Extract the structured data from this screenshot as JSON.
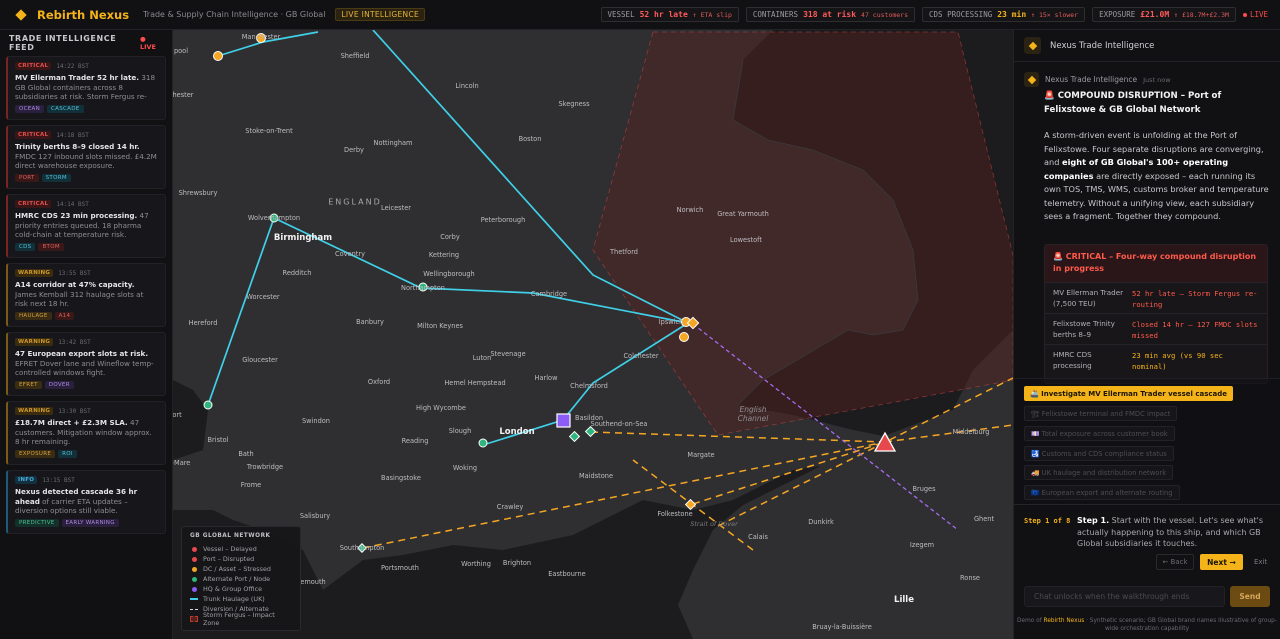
{
  "topbar": {
    "brand": "Rebirth Nexus",
    "subtitle": "Trade & Supply Chain Intelligence · GB Global",
    "mode": "LIVE INTELLIGENCE",
    "metrics": [
      {
        "label": "VESSEL",
        "value": "52 hr late",
        "delta": "↑ ETA slip"
      },
      {
        "label": "CONTAINERS",
        "value": "318 at risk",
        "delta": "47 customers"
      },
      {
        "label": "CDS PROCESSING",
        "value": "23 min",
        "delta": "↑ 15× slower"
      },
      {
        "label": "EXPOSURE",
        "value": "£21.0M",
        "delta": "↑ £18.7M+£2.3M"
      }
    ],
    "live": "LIVE"
  },
  "feed": {
    "title": "TRADE INTELLIGENCE FEED",
    "live": "● LIVE",
    "items": [
      {
        "severity": "CRITICAL",
        "time": "14:22 BST",
        "headline": "MV Ellerman Trader 52 hr late.",
        "body": " 318 GB Global containers across 8 subsidiaries at risk. Storm Fergus re-routing.",
        "tags": [
          "OCEAN",
          "CASCADE"
        ]
      },
      {
        "severity": "CRITICAL",
        "time": "14:18 BST",
        "headline": "Trinity berths 8–9 closed 14 hr.",
        "body": " FMDC 127 inbound slots missed. £4.2M direct warehouse exposure.",
        "tags": [
          "PORT",
          "STORM"
        ]
      },
      {
        "severity": "CRITICAL",
        "time": "14:14 BST",
        "headline": "HMRC CDS 23 min processing.",
        "body": " 47 priority entries queued. 18 pharma cold-chain at temperature risk.",
        "tags": [
          "CDS",
          "BTOM"
        ]
      },
      {
        "severity": "WARNING",
        "time": "13:55 BST",
        "headline": "A14 corridor at 47% capacity.",
        "body": " James Kemball 312 haulage slots at risk next 18 hr.",
        "tags": [
          "HAULAGE",
          "A14"
        ]
      },
      {
        "severity": "WARNING",
        "time": "13:42 BST",
        "headline": "47 European export slots at risk.",
        "body": " EFRET Dover lane and Wineflow temp-controlled windows fight.",
        "tags": [
          "EFRET",
          "DOVER"
        ]
      },
      {
        "severity": "WARNING",
        "time": "13:30 BST",
        "headline": "£18.7M direct + £2.3M SLA.",
        "body": " 47 customers. Mitigation window approx. 8 hr remaining.",
        "tags": [
          "EXPOSURE",
          "ROI"
        ]
      },
      {
        "severity": "INFO",
        "time": "13:15 BST",
        "headline": "Nexus detected cascade 36 hr ahead",
        "body": " of carrier ETA updates – diversion options still viable.",
        "tags": [
          "PREDICTIVE",
          "EARLY WARNING"
        ]
      }
    ]
  },
  "map": {
    "cities": [
      {
        "name": "Manchester",
        "big": false
      },
      {
        "name": "Sheffield",
        "big": false
      },
      {
        "name": "pool",
        "big": false
      },
      {
        "name": "Lincoln",
        "big": false
      },
      {
        "name": "Skegness",
        "big": false
      },
      {
        "name": "hester",
        "big": false
      },
      {
        "name": "Stoke-on-Trent",
        "big": false
      },
      {
        "name": "Nottingham",
        "big": false
      },
      {
        "name": "Boston",
        "big": false
      },
      {
        "name": "Derby",
        "big": false
      },
      {
        "name": "Shrewsbury",
        "big": false
      },
      {
        "name": "ENGLAND",
        "big": false
      },
      {
        "name": "Leicester",
        "big": false
      },
      {
        "name": "Peterborough",
        "big": false
      },
      {
        "name": "Norwich",
        "big": false
      },
      {
        "name": "Great Yarmouth",
        "big": false
      },
      {
        "name": "Wolverhampton",
        "big": false
      },
      {
        "name": "Birmingham",
        "big": true
      },
      {
        "name": "Corby",
        "big": false
      },
      {
        "name": "Lowestoft",
        "big": false
      },
      {
        "name": "Coventry",
        "big": false
      },
      {
        "name": "Kettering",
        "big": false
      },
      {
        "name": "Thetford",
        "big": false
      },
      {
        "name": "Redditch",
        "big": false
      },
      {
        "name": "Wellingborough",
        "big": false
      },
      {
        "name": "Northampton",
        "big": false
      },
      {
        "name": "Cambridge",
        "big": false
      },
      {
        "name": "Worcester",
        "big": false
      },
      {
        "name": "Hereford",
        "big": false
      },
      {
        "name": "Banbury",
        "big": false
      },
      {
        "name": "Milton Keynes",
        "big": false
      },
      {
        "name": "Ipswich",
        "big": false
      },
      {
        "name": "Luton",
        "big": false
      },
      {
        "name": "Stevenage",
        "big": false
      },
      {
        "name": "Colchester",
        "big": false
      },
      {
        "name": "Gloucester",
        "big": false
      },
      {
        "name": "Hemel Hempstead",
        "big": false
      },
      {
        "name": "Harlow",
        "big": false
      },
      {
        "name": "Oxford",
        "big": false
      },
      {
        "name": "Chelmsford",
        "big": false
      },
      {
        "name": "High Wycombe",
        "big": false
      },
      {
        "name": "Swindon",
        "big": false
      },
      {
        "name": "Basildon",
        "big": false
      },
      {
        "name": "Southend-on-Sea",
        "big": false
      },
      {
        "name": "Slough",
        "big": false
      },
      {
        "name": "London",
        "big": true
      },
      {
        "name": "Reading",
        "big": false
      },
      {
        "name": "Bristol",
        "big": false
      },
      {
        "name": "Bath",
        "big": false
      },
      {
        "name": "Margate",
        "big": false
      },
      {
        "name": "Woking",
        "big": false
      },
      {
        "name": "Trowbridge",
        "big": false
      },
      {
        "name": "Basingstoke",
        "big": false
      },
      {
        "name": "Maidstone",
        "big": false
      },
      {
        "name": "Frome",
        "big": false
      },
      {
        "name": "Middelburg",
        "big": false
      },
      {
        "name": "Bruges",
        "big": false
      },
      {
        "name": "Crawley",
        "big": false
      },
      {
        "name": "Folkestone",
        "big": false
      },
      {
        "name": "Dunkirk",
        "big": false
      },
      {
        "name": "Ghent",
        "big": false
      },
      {
        "name": "Salisbury",
        "big": false
      },
      {
        "name": "Calais",
        "big": false
      },
      {
        "name": "Southampton",
        "big": false
      },
      {
        "name": "Izegem",
        "big": false
      },
      {
        "name": "Portsmouth",
        "big": false
      },
      {
        "name": "Worthing",
        "big": false
      },
      {
        "name": "Brighton",
        "big": false
      },
      {
        "name": "Eastbourne",
        "big": false
      },
      {
        "name": "Ronse",
        "big": false
      },
      {
        "name": "Lille",
        "big": true
      },
      {
        "name": "emouth",
        "big": false
      },
      {
        "name": "Bruay-la-Buissière",
        "big": false
      },
      {
        "name": "ort",
        "big": false
      },
      {
        "name": "-Mare",
        "big": false
      }
    ],
    "seas": [
      "English Channel",
      "Strait of Dover"
    ],
    "legend": {
      "title": "GB GLOBAL NETWORK",
      "items": [
        {
          "label": "Vessel – Delayed",
          "color": "#e5484d"
        },
        {
          "label": "Port – Disrupted",
          "color": "#e5484d"
        },
        {
          "label": "DC / Asset – Stressed",
          "color": "#f5a623"
        },
        {
          "label": "Alternate Port / Node",
          "color": "#2fb57d"
        },
        {
          "label": "HQ & Group Office",
          "color": "#8b5cf6"
        },
        {
          "label": "Trunk Haulage (UK)",
          "color": "#3fd0e8"
        },
        {
          "label": "Diversion / Alternate",
          "color": "#d8d8d8"
        },
        {
          "label": "Storm Fergus – Impact Zone",
          "color": "#c0392b"
        }
      ]
    }
  },
  "panel": {
    "title": "Nexus Trade Intelligence",
    "sender": "Nexus Trade Intelligence",
    "sent": "Just now",
    "heading": "🚨 COMPOUND DISRUPTION – Port of Felixstowe & GB Global Network",
    "para_start": "A storm-driven event is unfolding at the Port of Felixstowe. Four separate disruptions are converging, and ",
    "para_bold": "eight of GB Global's 100+ operating companies",
    "para_end": " are directly exposed – each running its own TOS, TMS, WMS, customs broker and temperature telemetry. Without a unifying view, each subsidiary sees a fragment. Together they compound.",
    "critical": {
      "title": "🚨 CRITICAL – Four-way compound disruption in progress",
      "rows": [
        {
          "k": "MV Ellerman Trader (7,500 TEU)",
          "v": "52 hr late — Storm Fergus re-routing",
          "tone": "red"
        },
        {
          "k": "Felixstowe Trinity berths 8–9",
          "v": "Closed 14 hr — 127 FMDC slots missed",
          "tone": "red"
        },
        {
          "k": "HMRC CDS processing",
          "v": "23 min avg (vs 90 sec nominal)",
          "tone": "amber"
        }
      ]
    },
    "suggestions": {
      "primary": "🚢 Investigate MV Ellerman Trader vessel cascade",
      "items": [
        "🏗 Felixstowe terminal and FMDC impact",
        "💷 Total exposure across customer book",
        "🛃 Customs and CDS compliance status",
        "🚚 UK haulage and distribution network",
        "🇪🇺 European export and alternate routing"
      ]
    },
    "walkthrough": {
      "step": "Step 1 of 8",
      "step_lead": "Step 1.",
      "text": " Start with the vessel. Let's see what's actually happening to this ship, and which GB Global subsidiaries it touches.",
      "back": "← Back",
      "next": "Next →",
      "exit": "Exit"
    },
    "chat": {
      "placeholder": "Chat unlocks when the walkthrough ends",
      "send": "Send"
    },
    "footer_pre": "Demo of ",
    "footer_brand": "Rebirth Nexus",
    "footer_post": " · Synthetic scenario; GB Global brand names illustrative of group-wide orchestration capability"
  }
}
